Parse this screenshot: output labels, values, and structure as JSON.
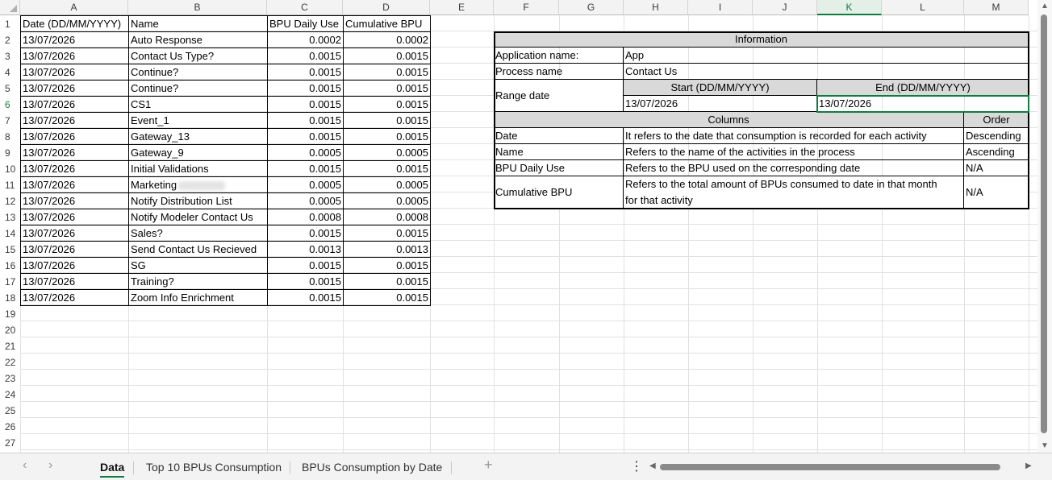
{
  "columns": [
    "A",
    "B",
    "C",
    "D",
    "E",
    "F",
    "G",
    "H",
    "I",
    "J",
    "K",
    "L",
    "M"
  ],
  "selected_column": "K",
  "selected_row": "6",
  "rows": [
    "1",
    "2",
    "3",
    "4",
    "5",
    "6",
    "7",
    "8",
    "9",
    "10",
    "11",
    "12",
    "13",
    "14",
    "15",
    "16",
    "17",
    "18",
    "19",
    "20",
    "21",
    "22",
    "23",
    "24",
    "25",
    "26",
    "27"
  ],
  "table": {
    "headers": [
      "Date (DD/MM/YYYY)",
      "Name",
      "BPU Daily Use",
      "Cumulative BPU"
    ],
    "records": [
      {
        "date": "13/07/2026",
        "name": "Auto Response",
        "daily": "0.0002",
        "cumulative": "0.0002"
      },
      {
        "date": "13/07/2026",
        "name": "Contact Us Type?",
        "daily": "0.0015",
        "cumulative": "0.0015"
      },
      {
        "date": "13/07/2026",
        "name": "Continue?",
        "daily": "0.0015",
        "cumulative": "0.0015"
      },
      {
        "date": "13/07/2026",
        "name": "Continue?",
        "daily": "0.0015",
        "cumulative": "0.0015"
      },
      {
        "date": "13/07/2026",
        "name": "CS1",
        "daily": "0.0015",
        "cumulative": "0.0015"
      },
      {
        "date": "13/07/2026",
        "name": "Event_1",
        "daily": "0.0015",
        "cumulative": "0.0015"
      },
      {
        "date": "13/07/2026",
        "name": "Gateway_13",
        "daily": "0.0015",
        "cumulative": "0.0015"
      },
      {
        "date": "13/07/2026",
        "name": "Gateway_9",
        "daily": "0.0005",
        "cumulative": "0.0005"
      },
      {
        "date": "13/07/2026",
        "name": "Initial Validations",
        "daily": "0.0015",
        "cumulative": "0.0015"
      },
      {
        "date": "13/07/2026",
        "name": "Marketing",
        "daily": "0.0005",
        "cumulative": "0.0005"
      },
      {
        "date": "13/07/2026",
        "name": "Notify Distribution List",
        "daily": "0.0005",
        "cumulative": "0.0005"
      },
      {
        "date": "13/07/2026",
        "name": "Notify Modeler Contact Us",
        "daily": "0.0008",
        "cumulative": "0.0008"
      },
      {
        "date": "13/07/2026",
        "name": "Sales?",
        "daily": "0.0015",
        "cumulative": "0.0015"
      },
      {
        "date": "13/07/2026",
        "name": "Send Contact Us Recieved",
        "daily": "0.0013",
        "cumulative": "0.0013"
      },
      {
        "date": "13/07/2026",
        "name": "SG",
        "daily": "0.0015",
        "cumulative": "0.0015"
      },
      {
        "date": "13/07/2026",
        "name": "Training?",
        "daily": "0.0015",
        "cumulative": "0.0015"
      },
      {
        "date": "13/07/2026",
        "name": "Zoom Info Enrichment",
        "daily": "0.0015",
        "cumulative": "0.0015"
      }
    ]
  },
  "info": {
    "title": "Information",
    "app_label": "Application name:",
    "app_value": "App",
    "process_label": "Process name",
    "process_value": "Contact Us",
    "range_label": "Range date",
    "start_header": "Start (DD/MM/YYYY)",
    "end_header": "End (DD/MM/YYYY)",
    "start_value": "13/07/2026",
    "end_value": "13/07/2026",
    "columns_header": "Columns",
    "order_header": "Order",
    "col_rows": [
      {
        "name": "Date",
        "desc": "It refers to the date that consumption is recorded for each activity",
        "order": "Descending"
      },
      {
        "name": "Name",
        "desc": "Refers to the name of the activities in the process",
        "order": "Ascending"
      },
      {
        "name": "BPU Daily Use",
        "desc": "Refers to the BPU used on the corresponding date",
        "order": "N/A"
      },
      {
        "name": "Cumulative BPU",
        "desc1": "Refers to the total amount of BPUs consumed to date in that month",
        "desc2": "for that activity",
        "order": "N/A"
      }
    ]
  },
  "sheets": [
    "Data",
    "Top 10 BPUs Consumption",
    "BPUs Consumption by Date"
  ],
  "active_sheet": "Data",
  "nav": {
    "prev": "‹",
    "next": "›",
    "add": "+",
    "more": "⋮"
  },
  "colors": {
    "accent": "#107c41",
    "header_fill": "#d9d9d9"
  }
}
